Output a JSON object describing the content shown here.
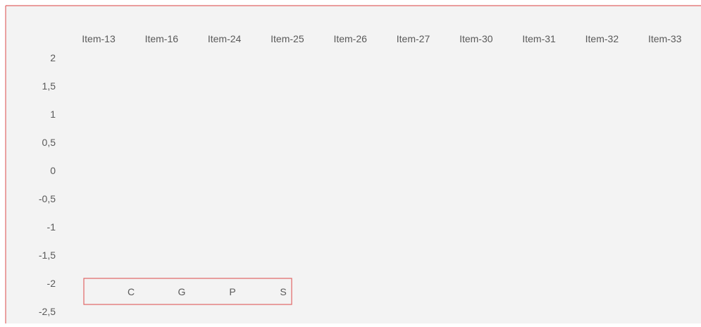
{
  "chart_data": {
    "type": "line",
    "categories": [
      "Item-13",
      "Item-16",
      "Item-24",
      "Item-25",
      "Item-26",
      "Item-27",
      "Item-30",
      "Item-31",
      "Item-32",
      "Item-33"
    ],
    "y_ticks": [
      "2",
      "1,5",
      "1",
      "0,5",
      "0",
      "-0,5",
      "-1",
      "-1,5",
      "-2",
      "-2,5"
    ],
    "ylim": [
      -2.5,
      2
    ],
    "grid": false,
    "legend_position": "bottom-left",
    "series": [
      {
        "name": "C",
        "values": []
      },
      {
        "name": "G",
        "values": []
      },
      {
        "name": "P",
        "values": []
      },
      {
        "name": "S",
        "values": []
      }
    ],
    "colors": {
      "background": "#f3f3f3",
      "border": "#e06666",
      "text": "#595959"
    }
  }
}
